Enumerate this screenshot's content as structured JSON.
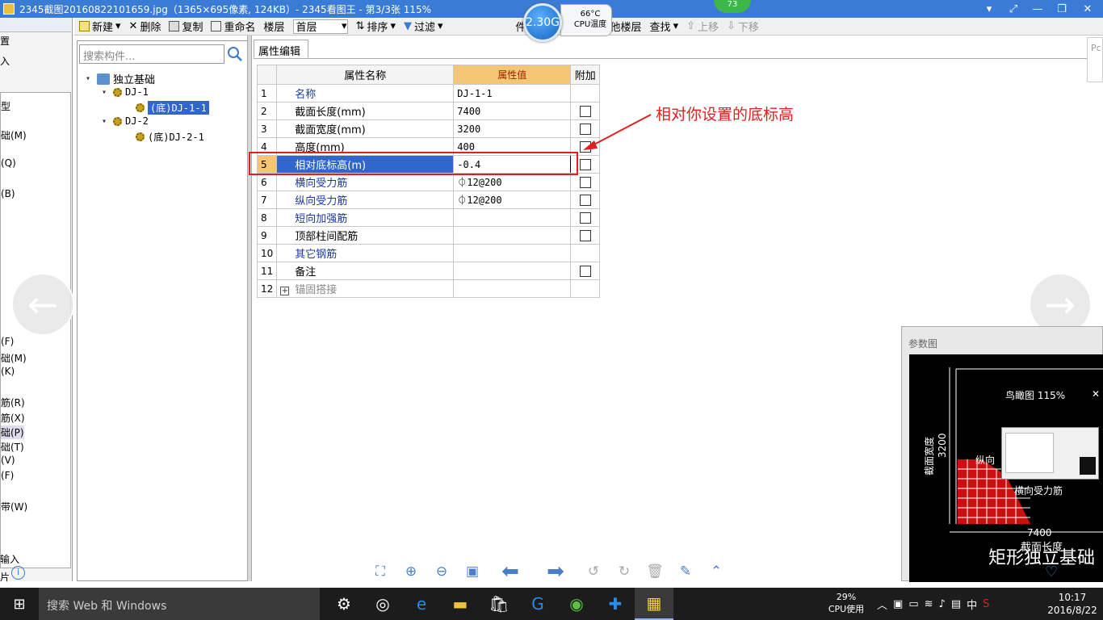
{
  "window": {
    "title": "2345截图20160822101659.jpg（1365×695像素, 124KB）- 2345看图王 - 第3/3张 115%"
  },
  "widgets": {
    "speed": "2.30G",
    "cpu_temp": "66°C",
    "cpu_temp_label": "CPU温度",
    "badge": "73"
  },
  "toolbar": {
    "new": "新建",
    "delete": "删除",
    "copy": "复制",
    "rename": "重命名",
    "floor_label": "楼层",
    "floor_value": "首层",
    "sort": "排序",
    "filter": "过滤",
    "copy_to_floor_partial": "件",
    "copy_to_floor": "复制构件到其他楼层",
    "find": "查找",
    "move_up": "上移",
    "move_down": "下移"
  },
  "left_strip": {
    "labels": [
      "置",
      "入",
      "型",
      "础(M)",
      "(Q)",
      "(B)",
      "(F)",
      "础(M)",
      "(K)",
      "筋(R)",
      "筋(X)",
      "础(P)",
      "础(T)",
      "(V)",
      "(F)",
      "带(W)",
      "输入",
      "片"
    ]
  },
  "tree": {
    "search_placeholder": "搜索构件...",
    "root": "独立基础",
    "groups": [
      {
        "name": "DJ-1",
        "child": "(底)DJ-1-1"
      },
      {
        "name": "DJ-2",
        "child": "(底)DJ-2-1"
      }
    ]
  },
  "property_panel": {
    "tab": "属性编辑",
    "headers": {
      "name": "属性名称",
      "value": "属性值",
      "extra": "附加"
    },
    "rows": [
      {
        "num": "1",
        "name": "名称",
        "value": "DJ-1-1",
        "checkbox": false
      },
      {
        "num": "2",
        "name": "截面长度(mm)",
        "value": "7400",
        "checkbox": true
      },
      {
        "num": "3",
        "name": "截面宽度(mm)",
        "value": "3200",
        "checkbox": true
      },
      {
        "num": "4",
        "name": "高度(mm)",
        "value": "400",
        "checkbox": true
      },
      {
        "num": "5",
        "name": "相对底标高(m)",
        "value": "-0.4",
        "checkbox": true
      },
      {
        "num": "6",
        "name": "横向受力筋",
        "value": "⏀12@200",
        "checkbox": true
      },
      {
        "num": "7",
        "name": "纵向受力筋",
        "value": "⏀12@200",
        "checkbox": true
      },
      {
        "num": "8",
        "name": "短向加强筋",
        "value": "",
        "checkbox": true
      },
      {
        "num": "9",
        "name": "顶部柱间配筋",
        "value": "",
        "checkbox": true
      },
      {
        "num": "10",
        "name": "其它钢筋",
        "value": "",
        "checkbox": false
      },
      {
        "num": "11",
        "name": "备注",
        "value": "",
        "checkbox": true
      },
      {
        "num": "12",
        "name": "锚固搭接",
        "value": "",
        "checkbox": false
      }
    ]
  },
  "annotation": {
    "text": "相对你设置的底标高"
  },
  "param_diagram": {
    "title": "参数图",
    "bird_view": "鸟瞰图 115%",
    "width_label": "截面宽度",
    "width_value": "3200",
    "length_value": "7400",
    "length_label": "截面长度",
    "long_bar": "纵向",
    "cross_bar": "横向受力筋",
    "caption": "矩形独立基础"
  },
  "taskbar": {
    "search": "搜索 Web 和 Windows",
    "cpu_percent": "29%",
    "cpu_label": "CPU使用",
    "ime": "中",
    "time": "10:17",
    "date": "2016/8/22"
  },
  "colors": {
    "titlebar": "#3a7bd5",
    "selection": "#3366cc",
    "header_value": "#f5c673",
    "annotation": "#e02020"
  }
}
